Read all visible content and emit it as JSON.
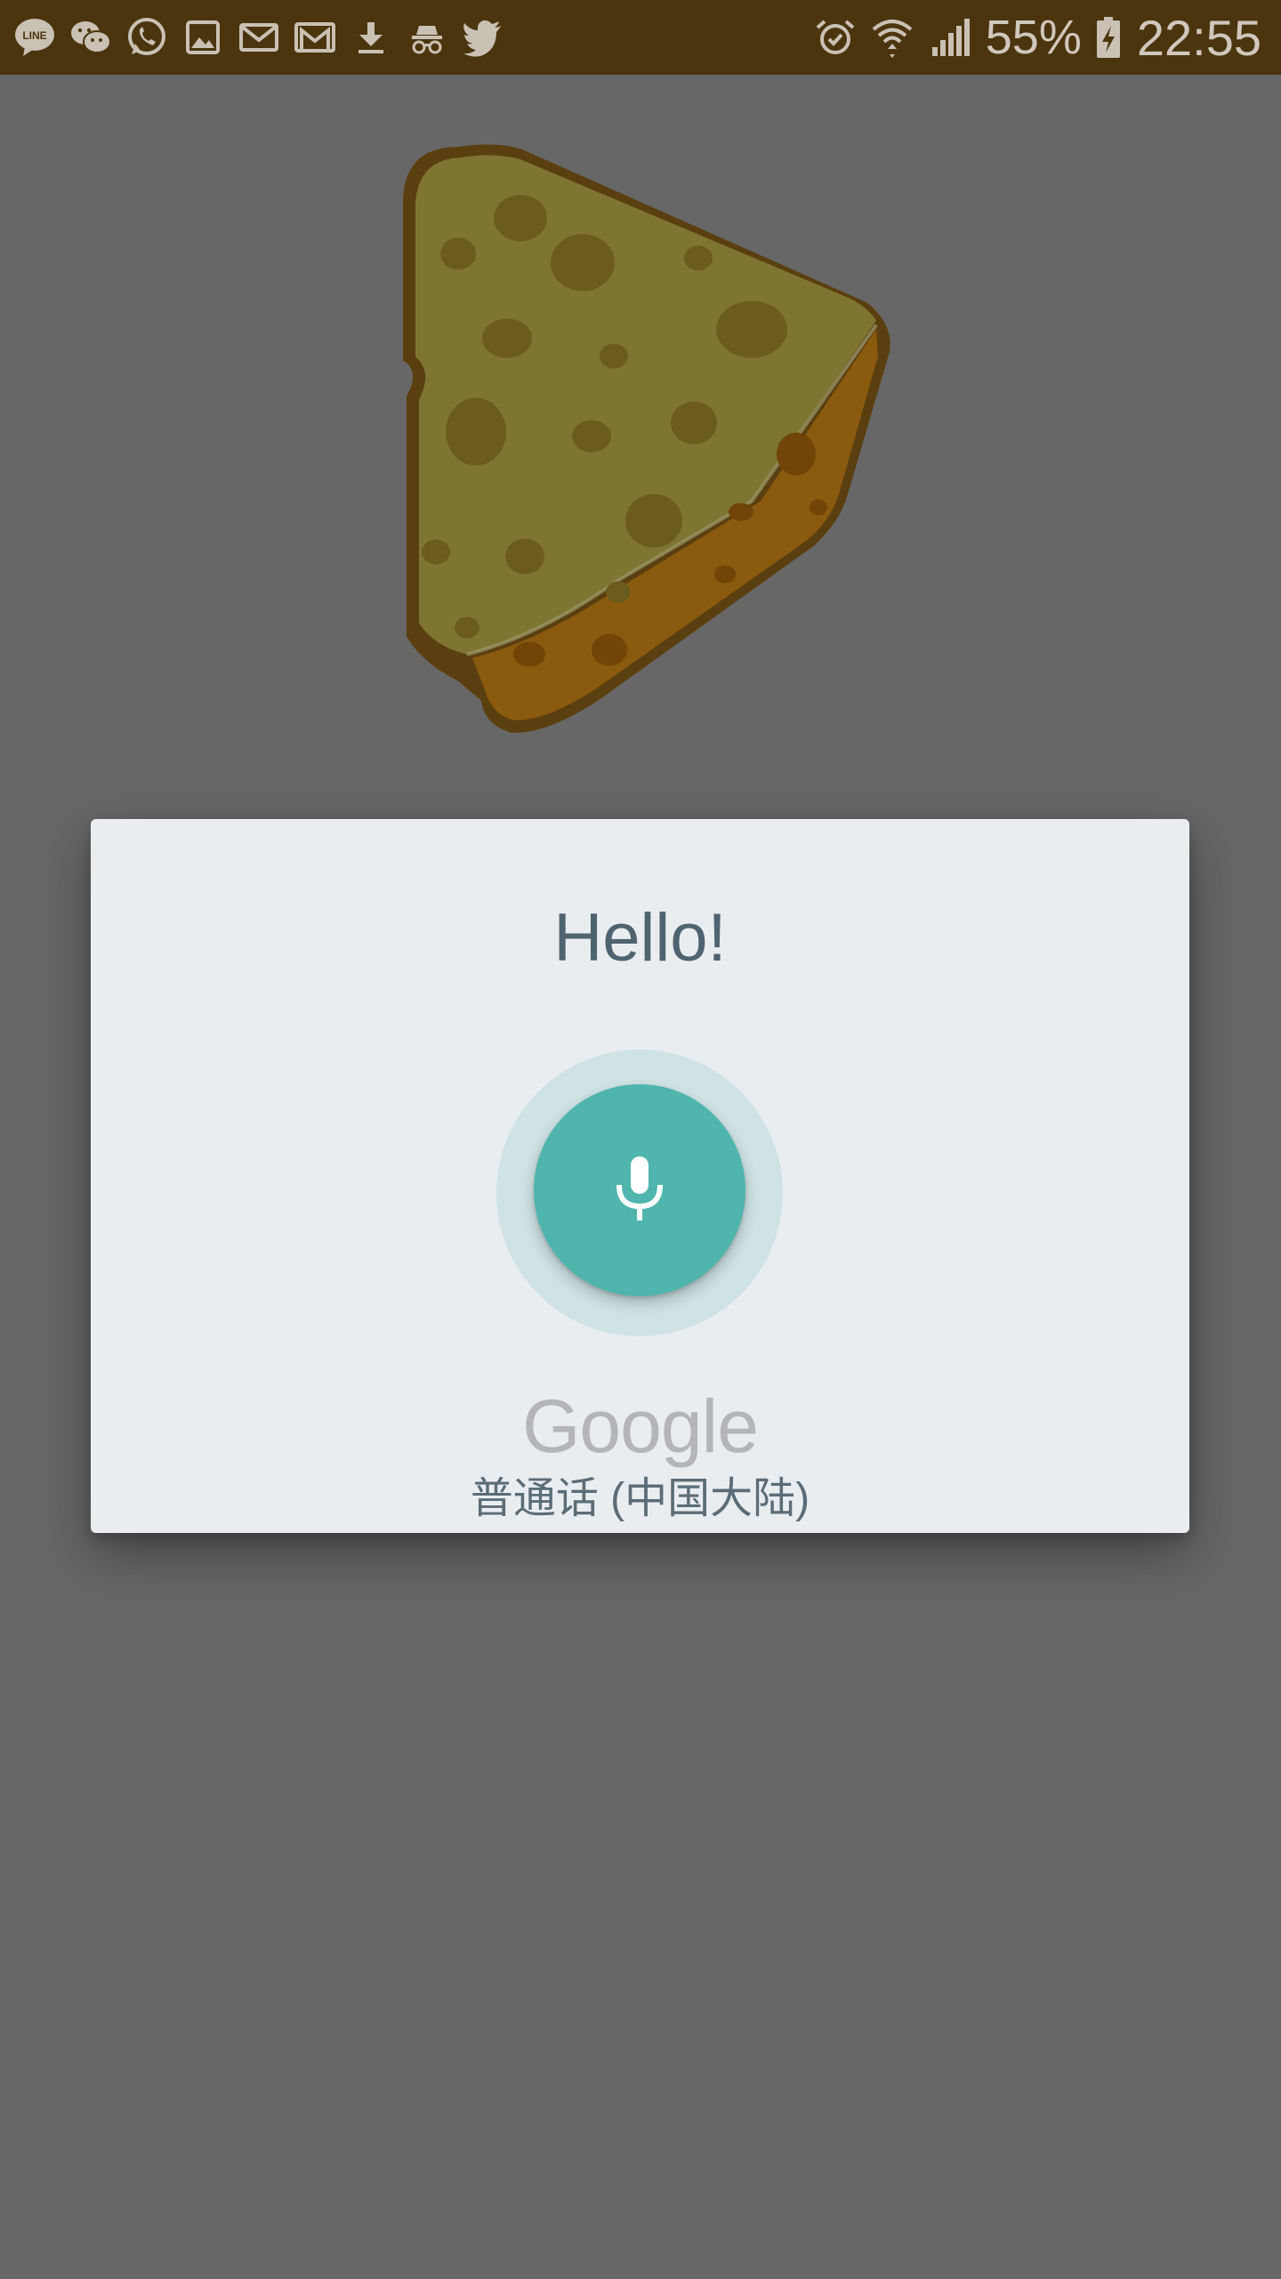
{
  "status_bar": {
    "notification_icons": [
      "line-icon",
      "wechat-icon",
      "whatsapp-icon",
      "gallery-icon",
      "email-icon",
      "gmail-icon",
      "download-icon",
      "incognito-icon",
      "twitter-icon"
    ],
    "system_icons": [
      "alarm-icon",
      "wifi-icon",
      "signal-icon"
    ],
    "battery_percent": "55%",
    "clock": "22:55",
    "background_color": "#4b350f"
  },
  "voice_dialog": {
    "title": "Hello!",
    "mic_button_color": "#4fb5ad",
    "brand": "Google",
    "language": "普通话 (中国大陆)"
  },
  "colors": {
    "scrim": "#676767",
    "dialog_bg": "#eaedf0",
    "mic_halo": "#cfe3e4"
  }
}
